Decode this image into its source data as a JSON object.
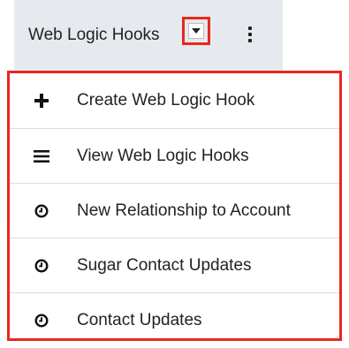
{
  "module_tab": {
    "label": "Web Logic Hooks",
    "caret_icon": "caret-down-icon",
    "more_icon": "kebab-vertical-icon"
  },
  "menu": {
    "items": [
      {
        "label": "Create Web Logic Hook",
        "icon": "plus-icon"
      },
      {
        "label": "View Web Logic Hooks",
        "icon": "list-icon"
      },
      {
        "label": "New Relationship to Account",
        "icon": "clock-icon"
      },
      {
        "label": "Sugar Contact Updates",
        "icon": "clock-icon"
      },
      {
        "label": "Contact Updates",
        "icon": "clock-icon"
      }
    ]
  },
  "colors": {
    "highlight": "#e8281e",
    "tab_bg": "#e6e9ee",
    "text": "#222222",
    "divider": "#d8dbe0"
  }
}
